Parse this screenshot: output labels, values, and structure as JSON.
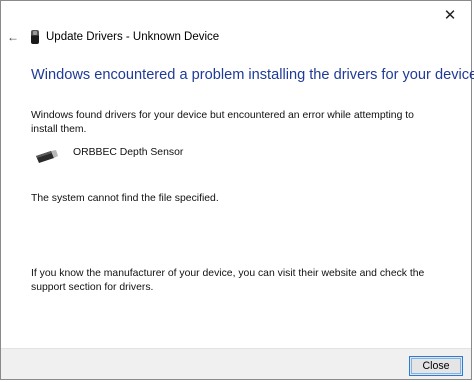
{
  "window": {
    "close_glyph": "✕",
    "back_glyph": "←",
    "title": "Update Drivers - Unknown Device"
  },
  "content": {
    "heading": "Windows encountered a problem installing the drivers for your device",
    "message": "Windows found drivers for your device but encountered an error while attempting to install them.",
    "device_name": "ORBBEC Depth Sensor",
    "error": "The system cannot find the file specified.",
    "help": "If you know the manufacturer of your device, you can visit their website and check the support section for drivers."
  },
  "footer": {
    "close_label": "Close"
  },
  "colors": {
    "heading": "#1f3b95",
    "button_border": "#2a7ad6",
    "footer_bg": "#f0f0f0"
  },
  "icons": [
    "close-icon",
    "back-arrow-icon",
    "usb-device-icon",
    "usb-drive-icon"
  ]
}
